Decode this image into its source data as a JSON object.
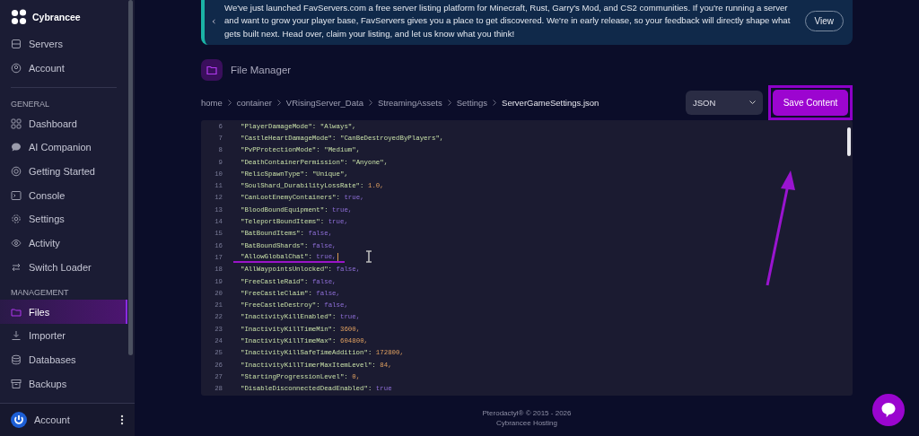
{
  "sidebar": {
    "brand": "Cybrancee",
    "top_items": [
      {
        "label": "Servers",
        "selected": false
      },
      {
        "label": "Account",
        "selected": false
      }
    ],
    "sections": [
      {
        "title": "GENERAL",
        "items": [
          {
            "label": "Dashboard",
            "selected": false
          },
          {
            "label": "AI Companion",
            "selected": false
          },
          {
            "label": "Getting Started",
            "selected": false
          },
          {
            "label": "Console",
            "selected": false
          },
          {
            "label": "Settings",
            "selected": false
          },
          {
            "label": "Activity",
            "selected": false
          },
          {
            "label": "Switch Loader",
            "selected": false
          }
        ]
      },
      {
        "title": "MANAGEMENT",
        "items": [
          {
            "label": "Files",
            "selected": true
          },
          {
            "label": "Importer",
            "selected": false
          },
          {
            "label": "Databases",
            "selected": false
          },
          {
            "label": "Backups",
            "selected": false
          }
        ]
      }
    ],
    "account": {
      "label": "Account"
    }
  },
  "banner": {
    "text": "We've just launched FavServers.com a free server listing platform for Minecraft, Rust, Garry's Mod, and CS2 communities. If you're running a server and want to grow your player base, FavServers gives you a place to get discovered. We're in early release, so your feedback will directly shape what gets built next. Head over, claim your listing, and let us know what you think!",
    "button": "View"
  },
  "file_manager": {
    "title": "File Manager",
    "breadcrumb": [
      "home",
      "container",
      "VRisingServer_Data",
      "StreamingAssets",
      "Settings",
      "ServerGameSettings.json"
    ],
    "format": "JSON",
    "save_button": "Save Content",
    "lines": [
      {
        "number": "6",
        "key": "\"PlayerDamageMode\":",
        "value": "\"Always\",",
        "kind": "string",
        "caret": false
      },
      {
        "number": "7",
        "key": "\"CastleHeartDamageMode\":",
        "value": "\"CanBeDestroyedByPlayers\",",
        "kind": "string",
        "caret": false
      },
      {
        "number": "8",
        "key": "\"PvPProtectionMode\":",
        "value": "\"Medium\",",
        "kind": "string",
        "caret": false
      },
      {
        "number": "9",
        "key": "\"DeathContainerPermission\":",
        "value": "\"Anyone\",",
        "kind": "string",
        "caret": false
      },
      {
        "number": "10",
        "key": "\"RelicSpawnType\":",
        "value": "\"Unique\",",
        "kind": "string",
        "caret": false
      },
      {
        "number": "11",
        "key": "\"SoulShard_DurabilityLossRate\":",
        "value": "1.0,",
        "kind": "number",
        "caret": false
      },
      {
        "number": "12",
        "key": "\"CanLootEnemyContainers\":",
        "value": "true,",
        "kind": "boolean",
        "caret": false
      },
      {
        "number": "13",
        "key": "\"BloodBoundEquipment\":",
        "value": "true,",
        "kind": "boolean",
        "caret": false
      },
      {
        "number": "14",
        "key": "\"TeleportBoundItems\":",
        "value": "true,",
        "kind": "boolean",
        "caret": false
      },
      {
        "number": "15",
        "key": "\"BatBoundItems\":",
        "value": "false,",
        "kind": "boolean",
        "caret": false
      },
      {
        "number": "16",
        "key": "\"BatBoundShards\":",
        "value": "false,",
        "kind": "boolean",
        "caret": false
      },
      {
        "number": "17",
        "key": "\"AllowGlobalChat\":",
        "value": "true,",
        "kind": "boolean",
        "caret": true
      },
      {
        "number": "18",
        "key": "\"AllWaypointsUnlocked\":",
        "value": "false,",
        "kind": "boolean",
        "caret": false
      },
      {
        "number": "19",
        "key": "\"FreeCastleRaid\":",
        "value": "false,",
        "kind": "boolean",
        "caret": false
      },
      {
        "number": "20",
        "key": "\"FreeCastleClaim\":",
        "value": "false,",
        "kind": "boolean",
        "caret": false
      },
      {
        "number": "21",
        "key": "\"FreeCastleDestroy\":",
        "value": "false,",
        "kind": "boolean",
        "caret": false
      },
      {
        "number": "22",
        "key": "\"InactivityKillEnabled\":",
        "value": "true,",
        "kind": "boolean",
        "caret": false
      },
      {
        "number": "23",
        "key": "\"InactivityKillTimeMin\":",
        "value": "3600,",
        "kind": "number",
        "caret": false
      },
      {
        "number": "24",
        "key": "\"InactivityKillTimeMax\":",
        "value": "604800,",
        "kind": "number",
        "caret": false
      },
      {
        "number": "25",
        "key": "\"InactivityKillSafeTimeAddition\":",
        "value": "172800,",
        "kind": "number",
        "caret": false
      },
      {
        "number": "26",
        "key": "\"InactivityKillTimerMaxItemLevel\":",
        "value": "84,",
        "kind": "number",
        "caret": false
      },
      {
        "number": "27",
        "key": "\"StartingProgressionLevel\":",
        "value": "0,",
        "kind": "number",
        "caret": false
      },
      {
        "number": "28",
        "key": "\"DisableDisconnectedDeadEnabled\":",
        "value": "true",
        "kind": "boolean",
        "caret": false
      }
    ]
  },
  "footer": {
    "line_1": "Pterodactyl® © 2015 - 2026",
    "line_2": "Cybrancee Hosting"
  }
}
